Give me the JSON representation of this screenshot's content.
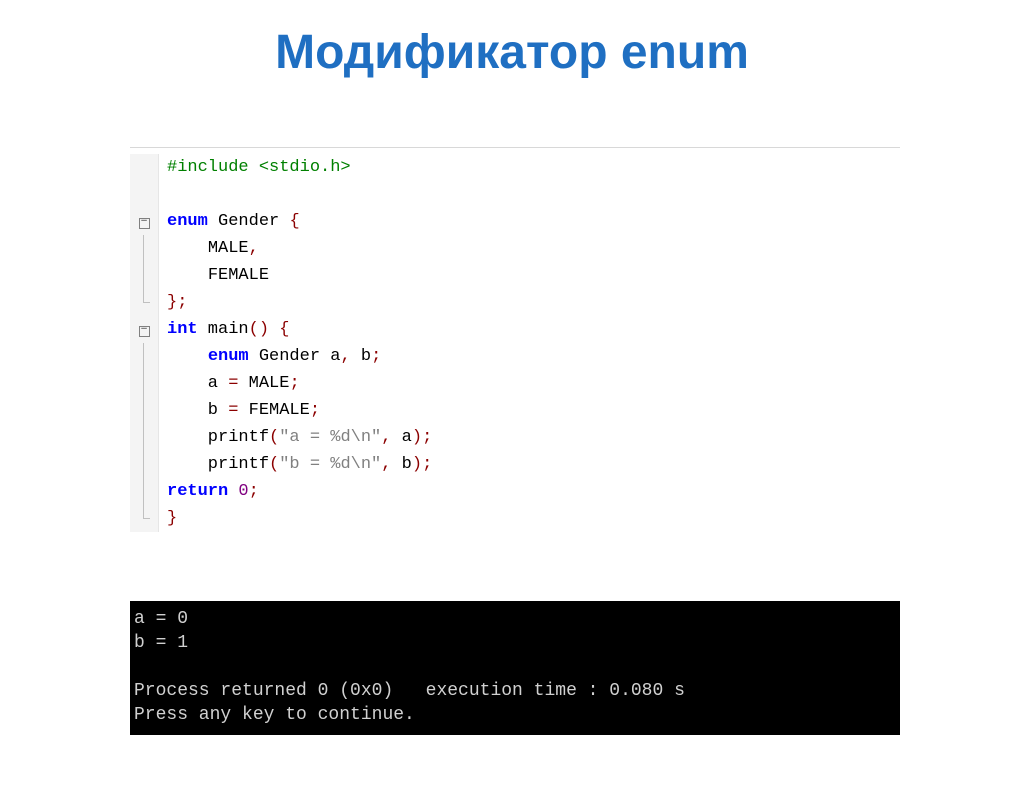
{
  "title": "Модификатор enum",
  "code": {
    "include": "#include <stdio.h>",
    "enum_decl": "enum",
    "enum_name": " Gender ",
    "brace_open": "{",
    "male": "MALE",
    "comma": ",",
    "female": "FEMALE",
    "close_decl_brace": "}",
    "close_decl_semi": ";",
    "int": "int",
    "main": " main",
    "paren_open": "(",
    "paren_close": ")",
    "brace_open2": " {",
    "decl_ab_enum": "enum",
    "decl_ab_rest": " Gender a",
    "decl_ab_comma": ",",
    "decl_ab_b": " b",
    "decl_ab_semi": ";",
    "a_eq": "    a ",
    "eq1": "=",
    "male2": " MALE",
    "semi": ";",
    "b_eq": "    b ",
    "eq2": "=",
    "female2": " FEMALE",
    "printf1_fn": "    printf",
    "printf1_po": "(",
    "printf1_str": "\"a = %d\\n\"",
    "printf1_cm": ",",
    "printf1_arg": " a",
    "printf1_pc": ");",
    "printf2_fn": "    printf",
    "printf2_po": "(",
    "printf2_str": "\"b = %d\\n\"",
    "printf2_cm": ",",
    "printf2_arg": " b",
    "printf2_pc": ");",
    "return": "return",
    "zero": " 0",
    "ret_semi": ";",
    "close_brace": "}"
  },
  "console": {
    "line1": "a = 0",
    "line2": "b = 1",
    "line3": " ",
    "line4": "Process returned 0 (0x0)   execution time : 0.080 s",
    "line5": "Press any key to continue."
  }
}
